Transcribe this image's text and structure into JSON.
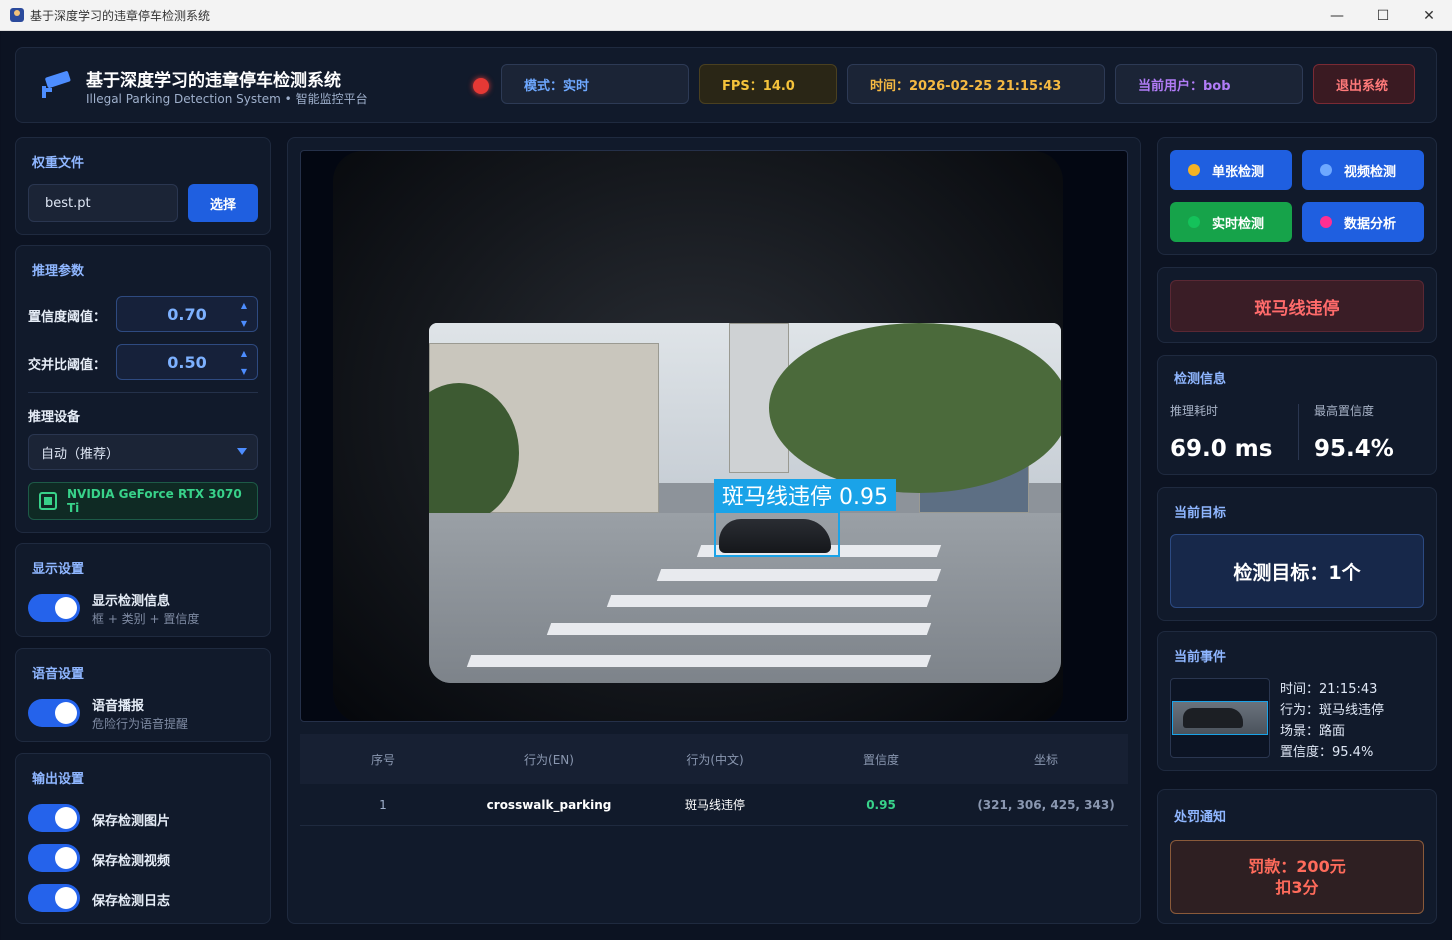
{
  "window": {
    "title": "基于深度学习的违章停车检测系统",
    "minimize": "—",
    "maximize": "☐",
    "close": "✕"
  },
  "header": {
    "title": "基于深度学习的违章停车检测系统",
    "subtitle": "Illegal Parking Detection System • 智能监控平台",
    "mode": "模式：实时",
    "fps": "FPS：14.0",
    "time": "时间：2026-02-25 21:15:43",
    "user": "当前用户：bob",
    "logout": "退出系统",
    "recording_color": "#e53935"
  },
  "weights": {
    "title": "权重文件",
    "value": "best.pt",
    "select_label": "选择"
  },
  "inference": {
    "title": "推理参数",
    "conf_label": "置信度阈值：",
    "conf_value": "0.70",
    "iou_label": "交并比阈值：",
    "iou_value": "0.50",
    "device_label": "推理设备",
    "device_value": "自动（推荐）",
    "gpu": "NVIDIA GeForce RTX 3070 Ti"
  },
  "display": {
    "title": "显示设置",
    "toggle_label": "显示检测信息",
    "toggle_sub": "框 + 类别 + 置信度",
    "enabled": true
  },
  "voice": {
    "title": "语音设置",
    "toggle_label": "语音播报",
    "toggle_sub": "危险行为语音提醒",
    "enabled": true
  },
  "output": {
    "title": "输出设置",
    "items": [
      {
        "label": "保存检测图片",
        "enabled": true
      },
      {
        "label": "保存检测视频",
        "enabled": true
      },
      {
        "label": "保存检测日志",
        "enabled": true
      }
    ]
  },
  "video": {
    "detection_label": "斑马线违停 0.95",
    "box_color": "#1aa3e8"
  },
  "table": {
    "headers": [
      "序号",
      "行为(EN)",
      "行为(中文)",
      "置信度",
      "坐标"
    ],
    "rows": [
      {
        "index": "1",
        "behavior_en": "crosswalk_parking",
        "behavior_cn": "斑马线违停",
        "confidence": "0.95",
        "coords": "(321, 306, 425, 343)"
      }
    ]
  },
  "modes": [
    {
      "label": "单张检测",
      "dot_color": "#f5b324"
    },
    {
      "label": "视频检测",
      "dot_color": "#6ea8ff"
    },
    {
      "label": "实时检测",
      "dot_color": "#14c25a"
    },
    {
      "label": "数据分析",
      "dot_color": "#ff2f92"
    }
  ],
  "violation": "斑马线违停",
  "detection_info": {
    "title": "检测信息",
    "time_label": "推理耗时",
    "time_value": "69.0 ms",
    "conf_label": "最高置信度",
    "conf_value": "95.4%"
  },
  "current_target": {
    "title": "当前目标",
    "value": "检测目标：1个"
  },
  "current_event": {
    "title": "当前事件",
    "time": "时间：21:15:43",
    "behavior": "行为：斑马线违停",
    "scene": "场景：路面",
    "confidence": "置信度：95.4%"
  },
  "penalty": {
    "title": "处罚通知",
    "fine": "罚款：200元",
    "points": "扣3分"
  }
}
